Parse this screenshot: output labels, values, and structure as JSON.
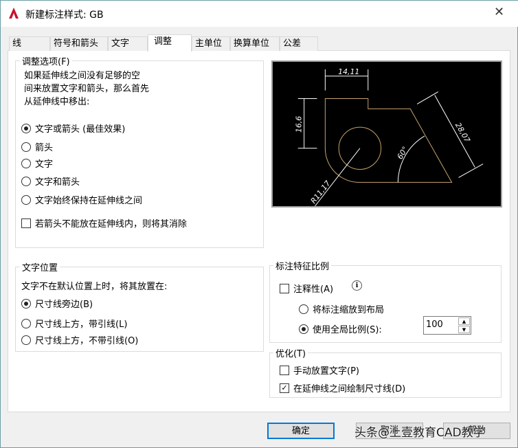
{
  "window": {
    "title": "新建标注样式: GB",
    "close": "✕"
  },
  "tabs": [
    "线",
    "符号和箭头",
    "文字",
    "调整",
    "主单位",
    "换算单位",
    "公差"
  ],
  "fit_options": {
    "label": "调整选项(F)",
    "description": [
      "如果延伸线之间没有足够的空",
      "间来放置文字和箭头，那么首先",
      "从延伸线中移出:"
    ],
    "radios": [
      {
        "label": "文字或箭头 (最佳效果)",
        "selected": true
      },
      {
        "label": "箭头",
        "selected": false
      },
      {
        "label": "文字",
        "selected": false
      },
      {
        "label": "文字和箭头",
        "selected": false
      },
      {
        "label": "文字始终保持在延伸线之间",
        "selected": false
      }
    ],
    "suppress": {
      "label": "若箭头不能放在延伸线内，则将其消除",
      "checked": false
    }
  },
  "text_placement": {
    "label": "文字位置",
    "description": "文字不在默认位置上时，将其放置在:",
    "radios": [
      {
        "label": "尺寸线旁边(B)",
        "selected": true
      },
      {
        "label": "尺寸线上方，带引线(L)",
        "selected": false
      },
      {
        "label": "尺寸线上方，不带引线(O)",
        "selected": false
      }
    ]
  },
  "scale": {
    "label": "标注特征比例",
    "annotative": {
      "label": "注释性(A)",
      "checked": false,
      "info": "ℹ"
    },
    "radios": [
      {
        "label": "将标注缩放到布局",
        "selected": false
      },
      {
        "label": "使用全局比例(S):",
        "selected": true
      }
    ],
    "value": "100"
  },
  "fine_tuning": {
    "label": "优化(T)",
    "checks": [
      {
        "label": "手动放置文字(P)",
        "checked": false
      },
      {
        "label": "在延伸线之间绘制尺寸线(D)",
        "checked": true
      }
    ]
  },
  "preview": {
    "dims": [
      "14,11",
      "16,6",
      "28,07",
      "60°",
      "R11,17"
    ]
  },
  "buttons": {
    "ok": "确定",
    "cancel": "取消",
    "help": "帮助"
  },
  "watermark": "头条@上壹教育CAD教学"
}
